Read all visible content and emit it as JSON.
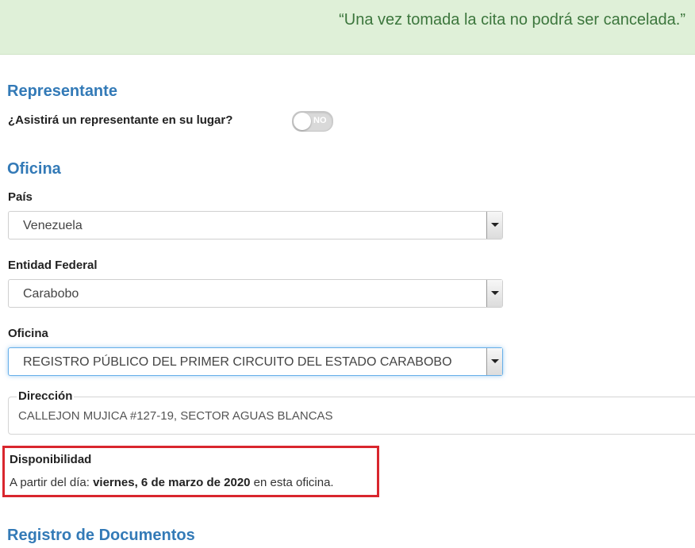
{
  "notice": {
    "text": "“Una vez tomada la cita no podrá ser cancelada.”"
  },
  "representante": {
    "title": "Representante",
    "question": "¿Asistirá un representante en su lugar?",
    "toggle_text": "NO"
  },
  "oficina": {
    "title": "Oficina",
    "pais": {
      "label": "País",
      "value": "Venezuela"
    },
    "entidad": {
      "label": "Entidad Federal",
      "value": "Carabobo"
    },
    "oficina_select": {
      "label": "Oficina",
      "value": "REGISTRO PÚBLICO DEL PRIMER CIRCUITO DEL ESTADO CARABOBO"
    },
    "direccion": {
      "label": "Dirección",
      "value": "CALLEJON MUJICA #127-19, SECTOR AGUAS BLANCAS"
    }
  },
  "disponibilidad": {
    "title": "Disponibilidad",
    "prefix": "A partir del día: ",
    "date": "viernes, 6 de marzo de 2020",
    "suffix": " en esta oficina."
  },
  "registro": {
    "title": "Registro de Documentos"
  },
  "colors": {
    "notice_bg": "#dff0d8",
    "notice_text": "#3c763d",
    "section_title": "#337ab7",
    "highlight_border": "#d9262e"
  }
}
